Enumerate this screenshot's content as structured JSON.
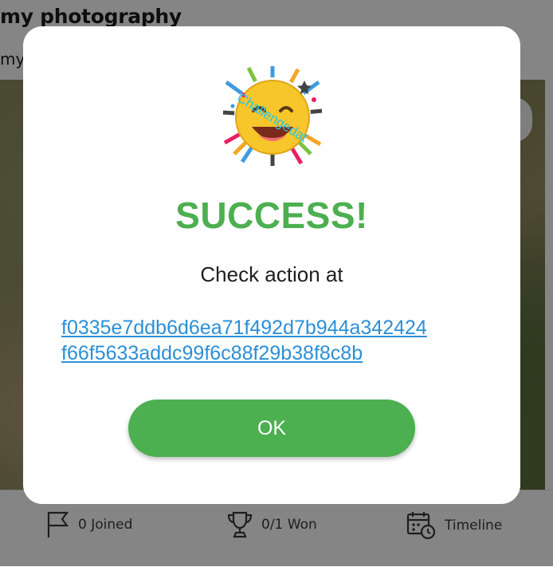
{
  "background": {
    "post_title": "my photography",
    "post_subtitle": "my",
    "stats": {
      "joined": "0 Joined",
      "won": "0/1 Won",
      "timeline": "Timeline"
    }
  },
  "modal": {
    "badge_text": "Challengedat",
    "title": "SUCCESS!",
    "message": "Check action at",
    "hash_line1": "f0335e7ddb6d6ea71f492d7b944a342424",
    "hash_line2": "f66f5633addc99f6c88f29b38f8c8b",
    "ok_label": "OK"
  },
  "colors": {
    "success_green": "#4caf50",
    "link_blue": "#2b8fd6"
  }
}
